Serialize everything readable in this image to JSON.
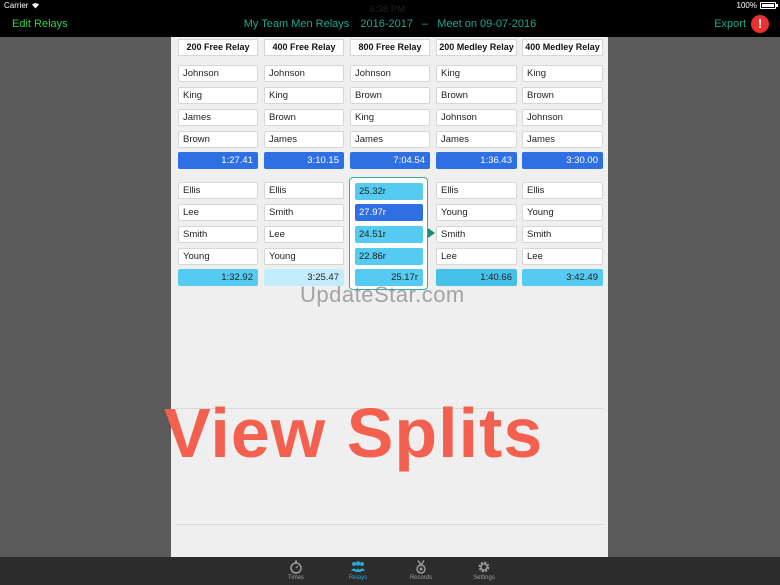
{
  "status": {
    "carrier": "Carrier",
    "time": "6:38 PM",
    "battery": "100%"
  },
  "nav": {
    "left": "Edit Relays",
    "team": "My Team Men Relays",
    "season": "2016-2017",
    "dash": "–",
    "meet": "Meet on 09-07-2016",
    "export": "Export",
    "alert": "!"
  },
  "relays": [
    {
      "name": "200 Free Relay",
      "a": {
        "swimmers": [
          "Johnson",
          "King",
          "James",
          "Brown"
        ],
        "time": "1:27.41"
      },
      "b": {
        "swimmers": [
          "Ellis",
          "Lee",
          "Smith",
          "Young"
        ],
        "time": "1:32.92"
      }
    },
    {
      "name": "400 Free Relay",
      "a": {
        "swimmers": [
          "Johnson",
          "King",
          "Brown",
          "James"
        ],
        "time": "3:10.15"
      },
      "b": {
        "swimmers": [
          "Ellis",
          "Smith",
          "Lee",
          "Young"
        ],
        "time": "3:25.47"
      }
    },
    {
      "name": "800 Free Relay",
      "a": {
        "swimmers": [
          "Johnson",
          "Brown",
          "King",
          "James"
        ],
        "time": "7:04.54"
      },
      "b": {
        "splits": [
          "25.32r",
          "27.97r",
          "24.51r",
          "22.86r"
        ],
        "time": "25.17r"
      }
    },
    {
      "name": "200 Medley Relay",
      "a": {
        "swimmers": [
          "King",
          "Brown",
          "Johnson",
          "James"
        ],
        "time": "1:36.43"
      },
      "b": {
        "swimmers": [
          "Ellis",
          "Young",
          "Smith",
          "Lee"
        ],
        "time": "1:40.66"
      }
    },
    {
      "name": "400 Medley Relay",
      "a": {
        "swimmers": [
          "King",
          "Brown",
          "Johnson",
          "James"
        ],
        "time": "3:30.00"
      },
      "b": {
        "swimmers": [
          "Ellis",
          "Young",
          "Smith",
          "Lee"
        ],
        "time": "3:42.49"
      }
    }
  ],
  "watermark": "UpdateStar.com",
  "overlay": "View Splits",
  "tabs": [
    {
      "label": "Times",
      "icon": "stopwatch-icon"
    },
    {
      "label": "Relays",
      "icon": "team-icon",
      "active": true
    },
    {
      "label": "Records",
      "icon": "medal-icon"
    },
    {
      "label": "Settings",
      "icon": "gear-icon"
    }
  ],
  "colors": {
    "accent": "#1fa88e",
    "edit": "#2fd04a",
    "blue": "#2f6fe4",
    "cyan": "#55cbf2",
    "overlay": "#f4604f"
  }
}
